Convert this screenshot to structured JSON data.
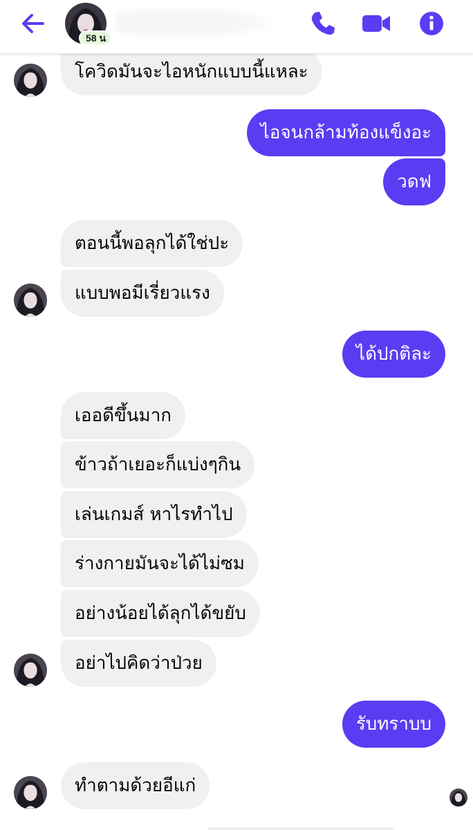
{
  "header": {
    "presence": "58 น",
    "accent_color": "#5b3cf2",
    "icons": [
      "back-arrow-icon",
      "phone-icon",
      "video-camera-icon",
      "info-icon"
    ]
  },
  "messages": [
    {
      "side": "in",
      "text": "โควิดมันจะไอหนักแบบนี้แหละ"
    },
    {
      "side": "out",
      "text": "ไอจนกล้ามท้องแข็งอะ"
    },
    {
      "side": "out",
      "text": "วดฟ"
    },
    {
      "side": "in",
      "text": "ตอนนี้พอลุกได้ใช่ปะ"
    },
    {
      "side": "in",
      "text": "แบบพอมีเรี่ยวแรง"
    },
    {
      "side": "out",
      "text": "ได้ปกติละ"
    },
    {
      "side": "in",
      "text": "เออดีขึ้นมาก"
    },
    {
      "side": "in",
      "text": "ข้าวถ้าเยอะก็แบ่งๆกิน"
    },
    {
      "side": "in",
      "text": "เล่นเกมส์ หาไรทำไป"
    },
    {
      "side": "in",
      "text": "ร่างกายมันจะได้ไม่ซม"
    },
    {
      "side": "in",
      "text": "อย่างน้อยได้ลุกได้ขยับ"
    },
    {
      "side": "in",
      "text": "อย่าไปคิดว่าป่วย"
    },
    {
      "side": "out",
      "text": "รับทราบบ"
    },
    {
      "side": "in",
      "text": "ทำตามด้วยอีแก่"
    }
  ],
  "colors": {
    "incoming_bubble": "#f0f0f0",
    "outgoing_bubble": "#5b3cf2",
    "presence_badge": "#e6f7d8"
  }
}
